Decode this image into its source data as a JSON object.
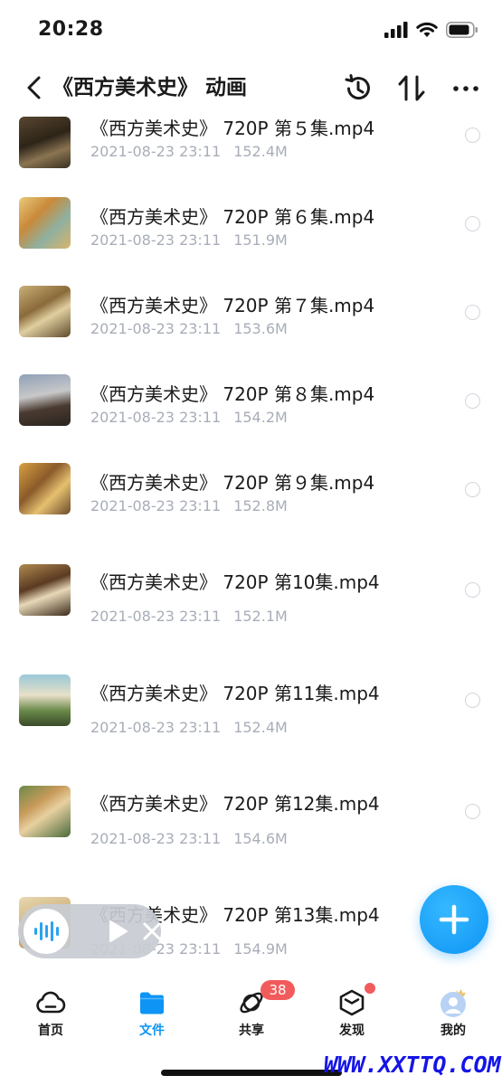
{
  "status_bar": {
    "time": "20:28"
  },
  "header": {
    "title": "《西方美术史》 动画",
    "icons": [
      "back-arrow-icon",
      "history-icon",
      "sort-icon",
      "more-icon"
    ]
  },
  "files": [
    {
      "name": "《西方美术史》 720P 第５集.mp4",
      "date": "2021-08-23 23:11",
      "size": "152.4M"
    },
    {
      "name": "《西方美术史》 720P 第６集.mp4",
      "date": "2021-08-23 23:11",
      "size": "151.9M"
    },
    {
      "name": "《西方美术史》 720P 第７集.mp4",
      "date": "2021-08-23 23:11",
      "size": "153.6M"
    },
    {
      "name": "《西方美术史》 720P 第８集.mp4",
      "date": "2021-08-23 23:11",
      "size": "154.2M"
    },
    {
      "name": "《西方美术史》 720P 第９集.mp4",
      "date": "2021-08-23 23:11",
      "size": "152.8M"
    },
    {
      "name": "《西方美术史》 720P 第10集.mp4",
      "date": "2021-08-23 23:11",
      "size": "152.1M"
    },
    {
      "name": "《西方美术史》 720P 第11集.mp4",
      "date": "2021-08-23 23:11",
      "size": "152.4M"
    },
    {
      "name": "《西方美术史》 720P 第12集.mp4",
      "date": "2021-08-23 23:11",
      "size": "154.6M"
    },
    {
      "name": "《西方美术史》 720P 第13集.mp4",
      "date": "2021-08-23 23:11",
      "size": "154.9M"
    }
  ],
  "tabs": [
    {
      "label": "首页",
      "icon": "cloud-icon"
    },
    {
      "label": "文件",
      "icon": "folder-icon"
    },
    {
      "label": "共享",
      "icon": "orbit-icon",
      "badge": "38"
    },
    {
      "label": "发现",
      "icon": "cube-icon"
    },
    {
      "label": "我的",
      "icon": "avatar-icon"
    }
  ],
  "active_tab": "文件",
  "watermark": "WWW.XXTTQ.COM",
  "colors": {
    "accent": "#0d94f5",
    "badge": "#f25b5b",
    "meta_text": "#a8adb8"
  }
}
